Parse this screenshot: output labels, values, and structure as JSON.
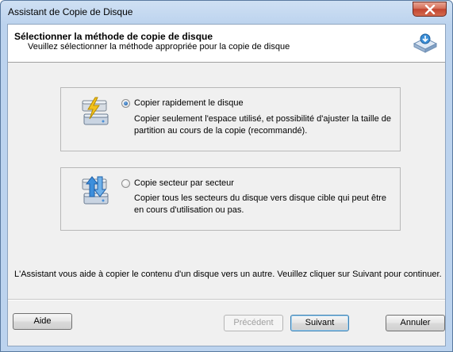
{
  "window": {
    "title": "Assistant de Copie de Disque"
  },
  "header": {
    "title": "Sélectionner la méthode de copie de disque",
    "subtitle": "Veuillez sélectionner la méthode appropriée pour la copie de disque",
    "icon": "disk-copy-icon"
  },
  "options": [
    {
      "label": "Copier rapidement le disque",
      "description": "Copier seulement l'espace utilisé, et possibilité d'ajuster la taille de partition au cours de la copie (recommandé).",
      "selected": true,
      "icon": "fast-copy-disk-icon"
    },
    {
      "label": "Copie secteur par secteur",
      "description": "Copier tous les secteurs du disque vers disque cible qui peut être en cours d'utilisation ou pas.",
      "selected": false,
      "icon": "sector-copy-disk-icon"
    }
  ],
  "footer": {
    "text": "L'Assistant vous aide à copier le contenu d'un disque vers un autre. Veuillez cliquer sur Suivant pour continuer."
  },
  "buttons": {
    "help": "Aide",
    "previous": "Précédent",
    "next": "Suivant",
    "cancel": "Annuler"
  },
  "colors": {
    "title_bar": "#bcd3ee",
    "close_button": "#c24430",
    "dialog_bg": "#f0f0f0",
    "selected_radio": "#1d5fa8"
  }
}
